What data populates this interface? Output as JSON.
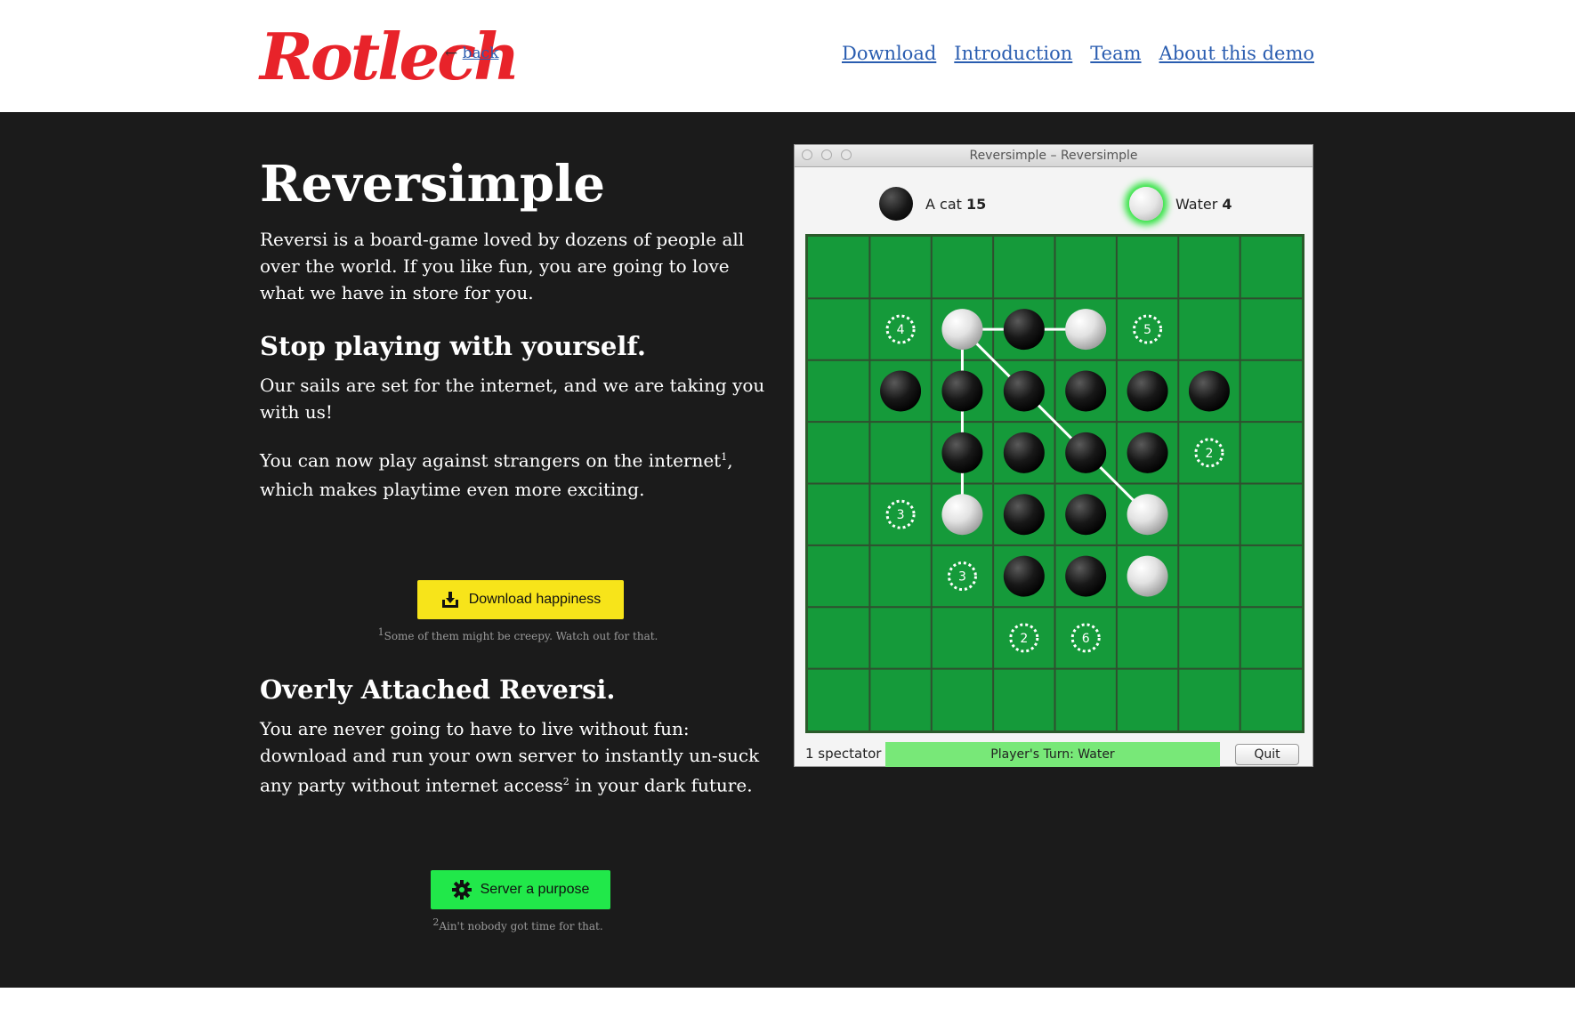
{
  "header": {
    "logo_text": "Rotlech",
    "back_arrow": "←",
    "back_label": "back",
    "nav": [
      {
        "label": "Download"
      },
      {
        "label": "Introduction"
      },
      {
        "label": "Team"
      },
      {
        "label": "About this demo"
      }
    ]
  },
  "main": {
    "title": "Reversimple",
    "intro": "Reversi is a board-game loved by dozens of people all over the world. If you like fun, you are going to love what we have in store for you.",
    "section1": {
      "heading": "Stop playing with yourself.",
      "p1": "Our sails are set for the internet, and we are taking you with us!",
      "p2_before": "You can now play against strangers on the internet",
      "p2_sup": "1",
      "p2_after": ", which makes playtime even more exciting.",
      "button_label": "Download happiness",
      "button_icon": "download-icon",
      "footnote": "Some of them might be creepy. Watch out for that.",
      "footnote_mark": "1"
    },
    "section2": {
      "heading": "Overly Attached Reversi.",
      "p_before": "You are never going to have to live without fun: download and run your own server to instantly un-suck any party without internet access",
      "p_sup": "2",
      "p_after": " in your dark future.",
      "button_label": "Server a purpose",
      "button_icon": "gear-icon",
      "footnote": "Ain't nobody got time for that.",
      "footnote_mark": "2"
    }
  },
  "game_window": {
    "title": "Reversimple – Reversimple",
    "player1": {
      "name": "A cat",
      "score": "15",
      "color": "black"
    },
    "player2": {
      "name": "Water",
      "score": "4",
      "color": "white",
      "active": true
    },
    "board": {
      "size": 8,
      "pieces": [
        {
          "row": 1,
          "col": 2,
          "color": "white"
        },
        {
          "row": 1,
          "col": 3,
          "color": "black"
        },
        {
          "row": 1,
          "col": 4,
          "color": "white"
        },
        {
          "row": 2,
          "col": 1,
          "color": "black"
        },
        {
          "row": 2,
          "col": 2,
          "color": "black"
        },
        {
          "row": 2,
          "col": 3,
          "color": "black"
        },
        {
          "row": 2,
          "col": 4,
          "color": "black"
        },
        {
          "row": 2,
          "col": 5,
          "color": "black"
        },
        {
          "row": 2,
          "col": 6,
          "color": "black"
        },
        {
          "row": 3,
          "col": 2,
          "color": "black"
        },
        {
          "row": 3,
          "col": 3,
          "color": "black"
        },
        {
          "row": 3,
          "col": 4,
          "color": "black"
        },
        {
          "row": 3,
          "col": 5,
          "color": "black"
        },
        {
          "row": 4,
          "col": 2,
          "color": "white"
        },
        {
          "row": 4,
          "col": 3,
          "color": "black"
        },
        {
          "row": 4,
          "col": 4,
          "color": "black"
        },
        {
          "row": 4,
          "col": 5,
          "color": "white"
        },
        {
          "row": 5,
          "col": 3,
          "color": "black"
        },
        {
          "row": 5,
          "col": 4,
          "color": "black"
        },
        {
          "row": 5,
          "col": 5,
          "color": "white"
        }
      ],
      "hints": [
        {
          "row": 1,
          "col": 1,
          "label": "4"
        },
        {
          "row": 1,
          "col": 5,
          "label": "5"
        },
        {
          "row": 3,
          "col": 6,
          "label": "2"
        },
        {
          "row": 4,
          "col": 1,
          "label": "3"
        },
        {
          "row": 5,
          "col": 2,
          "label": "3"
        },
        {
          "row": 6,
          "col": 3,
          "label": "2"
        },
        {
          "row": 6,
          "col": 4,
          "label": "6"
        }
      ],
      "links": [
        {
          "from": [
            1,
            2
          ],
          "to": [
            1,
            4
          ]
        },
        {
          "from": [
            1,
            2
          ],
          "to": [
            4,
            2
          ]
        },
        {
          "from": [
            1,
            2
          ],
          "to": [
            4,
            5
          ]
        }
      ]
    },
    "spectators": "1 spectator",
    "turn_label": "Player's Turn:  Water",
    "quit_label": "Quit"
  }
}
